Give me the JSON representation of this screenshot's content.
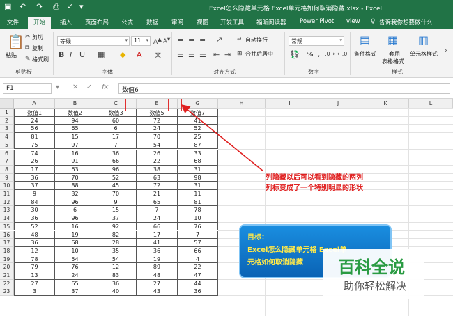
{
  "title_bar": {
    "window_title": "Excel怎么隐藏单元格 Excel单元格如何取消隐藏.xlsx  -  Excel"
  },
  "ribbon_tabs": [
    "文件",
    "开始",
    "插入",
    "页面布局",
    "公式",
    "数据",
    "审阅",
    "视图",
    "开发工具",
    "福昕阅读器",
    "Power Pivot",
    "view"
  ],
  "active_tab": "开始",
  "tell_me": "告诉我你想要做什么",
  "clipboard": {
    "paste": "粘贴",
    "cut": "剪切",
    "copy": "复制",
    "format_painter": "格式刷",
    "label": "剪贴板"
  },
  "font": {
    "name": "等线",
    "size": "11",
    "label": "字体"
  },
  "alignment": {
    "wrap": "自动换行",
    "merge": "合并后居中",
    "label": "对齐方式"
  },
  "number": {
    "format": "常规",
    "percent": "%",
    "comma": ",",
    "label": "数字"
  },
  "styles": {
    "conditional": "条件格式",
    "table_l1": "套用",
    "table_l2": "表格格式",
    "cell_styles": "单元格样式",
    "label": "样式"
  },
  "formula_bar": {
    "name_box": "F1",
    "formula": "数值6"
  },
  "columns": [
    "A",
    "B",
    "C",
    "E",
    "G",
    "H",
    "I",
    "J",
    "K",
    "L"
  ],
  "rows": [
    "1",
    "2",
    "3",
    "4",
    "5",
    "6",
    "7",
    "8",
    "9",
    "10",
    "11",
    "12",
    "13",
    "14",
    "15",
    "16",
    "17",
    "18",
    "19",
    "20",
    "21",
    "22",
    "23"
  ],
  "table": {
    "headers": [
      "数值1",
      "数值2",
      "数值3",
      "数值5",
      "数值7"
    ],
    "data": [
      [
        24,
        94,
        60,
        72,
        41
      ],
      [
        56,
        65,
        6,
        24,
        52
      ],
      [
        81,
        15,
        17,
        70,
        25
      ],
      [
        75,
        97,
        7,
        54,
        87
      ],
      [
        74,
        16,
        36,
        26,
        33
      ],
      [
        26,
        91,
        66,
        22,
        68
      ],
      [
        17,
        63,
        96,
        38,
        31
      ],
      [
        36,
        70,
        52,
        63,
        98
      ],
      [
        37,
        88,
        45,
        72,
        31
      ],
      [
        9,
        32,
        70,
        21,
        11
      ],
      [
        84,
        96,
        9,
        65,
        81
      ],
      [
        30,
        6,
        15,
        7,
        78
      ],
      [
        36,
        96,
        37,
        24,
        10
      ],
      [
        52,
        16,
        92,
        66,
        76
      ],
      [
        48,
        19,
        82,
        17,
        7
      ],
      [
        36,
        68,
        28,
        41,
        57
      ],
      [
        12,
        10,
        35,
        36,
        66
      ],
      [
        78,
        54,
        54,
        19,
        4
      ],
      [
        79,
        76,
        12,
        89,
        22
      ],
      [
        13,
        24,
        83,
        48,
        47
      ],
      [
        27,
        65,
        36,
        27,
        44
      ],
      [
        3,
        37,
        40,
        43,
        36
      ]
    ]
  },
  "annotation": {
    "line1": "列隐藏以后可以看到隐藏的两列",
    "line2": "列标变成了一个特别明显的形状"
  },
  "callout": {
    "label": "目标：",
    "line1": "Excel怎么隐藏单元格 Excel单",
    "line2": "元格如何取消隐藏"
  },
  "watermark": {
    "line1": "百科全说",
    "line2": "助你轻松解决"
  },
  "colors": {
    "excel_green": "#217346",
    "annotation_red": "#e02020",
    "callout_blue": "#0a63b5",
    "callout_text": "#ffe94a"
  }
}
